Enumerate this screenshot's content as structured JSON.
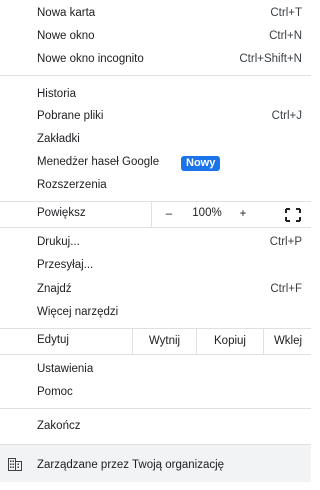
{
  "menu": {
    "new_tab": {
      "label": "Nowa karta",
      "shortcut": "Ctrl+T"
    },
    "new_window": {
      "label": "Nowe okno",
      "shortcut": "Ctrl+N"
    },
    "new_incognito": {
      "label": "Nowe okno incognito",
      "shortcut": "Ctrl+Shift+N"
    },
    "history": {
      "label": "Historia"
    },
    "downloads": {
      "label": "Pobrane pliki",
      "shortcut": "Ctrl+J"
    },
    "bookmarks": {
      "label": "Zakładki"
    },
    "password_manager": {
      "label": "Menedżer haseł Google",
      "badge": "Nowy"
    },
    "extensions": {
      "label": "Rozszerzenia"
    },
    "zoom": {
      "label": "Powiększ",
      "minus": "–",
      "value": "100%",
      "plus": "+",
      "fullscreen_icon": "fullscreen-icon"
    },
    "print": {
      "label": "Drukuj...",
      "shortcut": "Ctrl+P"
    },
    "cast": {
      "label": "Przesyłaj..."
    },
    "find": {
      "label": "Znajdź",
      "shortcut": "Ctrl+F"
    },
    "more_tools": {
      "label": "Więcej narzędzi"
    },
    "edit": {
      "label": "Edytuj",
      "cut": "Wytnij",
      "copy": "Kopiuj",
      "paste": "Wklej"
    },
    "settings": {
      "label": "Ustawienia"
    },
    "help": {
      "label": "Pomoc"
    },
    "exit": {
      "label": "Zakończ"
    },
    "managed": {
      "label": "Zarządzane przez Twoją organizację",
      "icon": "building-icon"
    }
  },
  "colors": {
    "accent": "#1a73e8",
    "separator": "#e0e0e0",
    "footer_bg": "#f1f3f4"
  }
}
